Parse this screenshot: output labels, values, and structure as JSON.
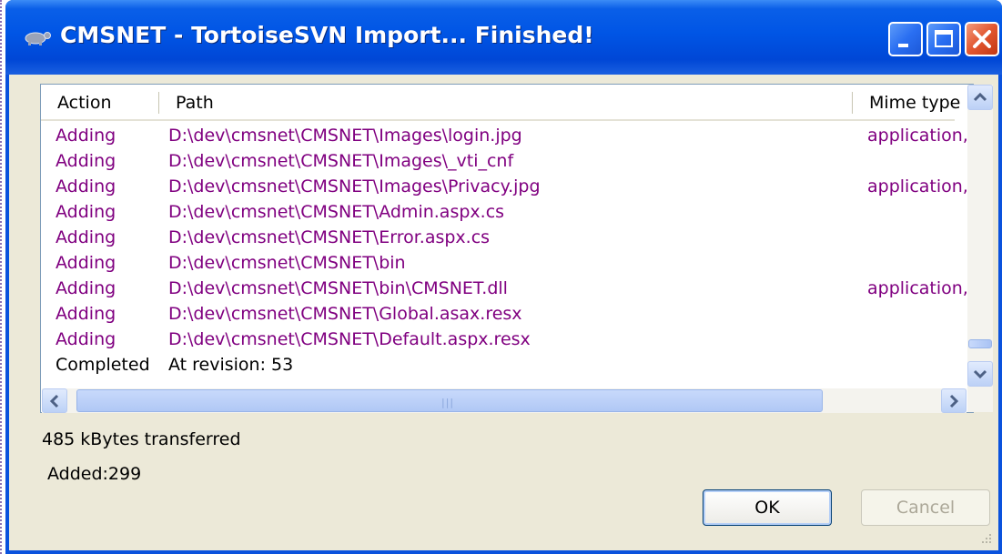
{
  "window": {
    "title": "CMSNET - TortoiseSVN Import... Finished!"
  },
  "list": {
    "columns": [
      "Action",
      "Path",
      "Mime type"
    ],
    "rows": [
      {
        "action": "Adding",
        "path": "D:\\dev\\cmsnet\\CMSNET\\Images\\login.jpg",
        "mime": "application,"
      },
      {
        "action": "Adding",
        "path": "D:\\dev\\cmsnet\\CMSNET\\Images\\_vti_cnf",
        "mime": ""
      },
      {
        "action": "Adding",
        "path": "D:\\dev\\cmsnet\\CMSNET\\Images\\Privacy.jpg",
        "mime": "application,"
      },
      {
        "action": "Adding",
        "path": "D:\\dev\\cmsnet\\CMSNET\\Admin.aspx.cs",
        "mime": ""
      },
      {
        "action": "Adding",
        "path": "D:\\dev\\cmsnet\\CMSNET\\Error.aspx.cs",
        "mime": ""
      },
      {
        "action": "Adding",
        "path": "D:\\dev\\cmsnet\\CMSNET\\bin",
        "mime": ""
      },
      {
        "action": "Adding",
        "path": "D:\\dev\\cmsnet\\CMSNET\\bin\\CMSNET.dll",
        "mime": "application,"
      },
      {
        "action": "Adding",
        "path": "D:\\dev\\cmsnet\\CMSNET\\Global.asax.resx",
        "mime": ""
      },
      {
        "action": "Adding",
        "path": "D:\\dev\\cmsnet\\CMSNET\\Default.aspx.resx",
        "mime": ""
      },
      {
        "action": "Completed",
        "path": "At revision: 53",
        "mime": ""
      }
    ]
  },
  "status": {
    "transferred": "485 kBytes transferred",
    "added": "Added:299"
  },
  "buttons": {
    "ok": "OK",
    "cancel": "Cancel"
  },
  "colors": {
    "added_text": "#800080",
    "completed_text": "#000000",
    "title_bar": "#0055e5"
  }
}
